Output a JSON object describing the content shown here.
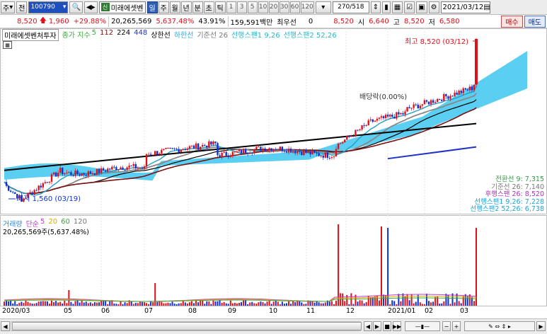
{
  "toolbar": {
    "type_label": "주",
    "jeon_label": "전",
    "stock_code": "100790",
    "stock_name": "미래에셋벤",
    "name_badge": "신",
    "periods": [
      "일",
      "주",
      "월",
      "년",
      "분",
      "초",
      "틱"
    ],
    "active_period": "일",
    "numbers": [
      "1",
      "3",
      "5",
      "10",
      "20",
      "30",
      "60",
      "120"
    ],
    "count": "270/518",
    "date": "2021/03/12"
  },
  "quote": {
    "price": "8,520",
    "change": "1,960",
    "change_pct": "+29.88%",
    "volume": "20,265,569",
    "volume_ratio": "5,637.48%",
    "turnover": "43.91%",
    "trade_value": "159,591백만",
    "pref_label": "최우선",
    "pref_value": "0",
    "current": "8,520",
    "open_label": "시",
    "open": "6,640",
    "high_label": "고",
    "high": "8,520",
    "low_label": "저",
    "low": "6,580",
    "buy_label": "매수",
    "sell_label": "매도"
  },
  "legend": {
    "title": "미래에셋벤처투자",
    "ma_label": "종가 지수",
    "ma5": "5",
    "ma112": "112",
    "ma224": "224",
    "ma448": "448",
    "upper": "상한선",
    "lower": "하한선",
    "base": "기준선 26",
    "span1": "선행스팬1 9,26",
    "span2": "선행스팬2 52,26"
  },
  "annotations": {
    "high": "최고 8,520 (03/12)",
    "low": "최저 1,560 (03/19)",
    "dividend": "배당락(0.00%)"
  },
  "right_legend": [
    "전환선 9: 7,315",
    "기준선 26: 7,140",
    "후행스팬 26: 8,520",
    "선행스팬1 9,26: 7,228",
    "선행스팬2 52,26: 6,738"
  ],
  "volume": {
    "label": "거래량",
    "simple": "단순",
    "ma5": "5",
    "ma20": "20",
    "ma60": "60",
    "ma120": "120",
    "total": "20,265,569주(5,637.48%)"
  },
  "xaxis": [
    "2020/03",
    "05",
    "06",
    "07",
    "08",
    "09",
    "10",
    "11",
    "12",
    "2021/01",
    "02",
    "03"
  ],
  "colors": {
    "up": "#e0101a",
    "down": "#1030d0",
    "cloud": "#3ec7ee",
    "ma5": "#22a0c4",
    "accent": "#2c5db8"
  }
}
